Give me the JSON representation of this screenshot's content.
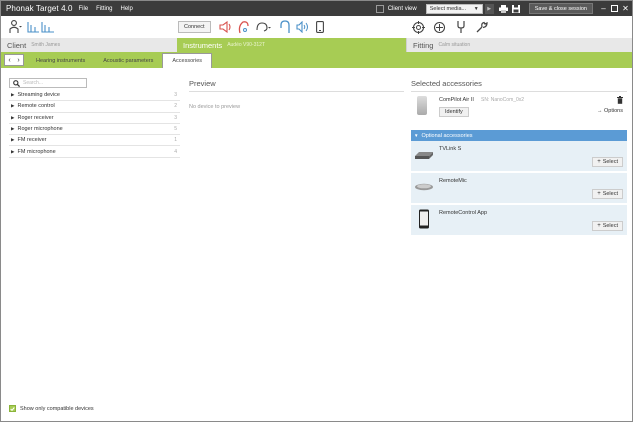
{
  "titlebar": {
    "app_title": "Phonak Target 4.0",
    "menu": [
      "File",
      "Fitting",
      "Help"
    ],
    "client_view_label": "Client view",
    "select_media": "Select media...",
    "save_close": "Save & close session",
    "icons": [
      "print-icon",
      "save-icon",
      "minimize-icon",
      "restore-icon",
      "close-icon"
    ]
  },
  "toolbar": {
    "connect_label": "Connect",
    "left_icons": [
      "person-icon",
      "audiogram-icon"
    ],
    "instrument_icons": [
      "speaker-icon",
      "hearing-aid-icon",
      "ear-icon",
      "hook-icon",
      "volume-icon",
      "phone-icon"
    ],
    "fitting_icons": [
      "target-icon",
      "crosshair-icon",
      "tuning-fork-icon",
      "wrench-icon"
    ]
  },
  "sections": {
    "client": {
      "name": "Client",
      "sub": "Smith James"
    },
    "instruments": {
      "name": "Instruments",
      "sub": "Audéo V90-312T"
    },
    "fitting": {
      "name": "Fitting",
      "sub": "Calm situation"
    }
  },
  "tabs": [
    "Hearing instruments",
    "Acoustic parameters",
    "Accessories"
  ],
  "active_tab": "Accessories",
  "search": {
    "placeholder": "Search..."
  },
  "categories": [
    {
      "name": "Streaming device",
      "count": "3"
    },
    {
      "name": "Remote control",
      "count": "2"
    },
    {
      "name": "Roger receiver",
      "count": "3"
    },
    {
      "name": "Roger microphone",
      "count": "5"
    },
    {
      "name": "FM receiver",
      "count": "1"
    },
    {
      "name": "FM microphone",
      "count": "4"
    }
  ],
  "preview": {
    "title": "Preview",
    "empty": "No device to preview"
  },
  "selected": {
    "title": "Selected accessories",
    "item": {
      "name": "ComPilot Air II",
      "sn": "SN: NanoCom_0x2"
    },
    "identify": "Identify",
    "options": "Options"
  },
  "optional": {
    "title": "Optional accessories",
    "select_label": "Select",
    "items": [
      {
        "name": "TVLink S"
      },
      {
        "name": "RemoteMic"
      },
      {
        "name": "RemoteControl App"
      }
    ]
  },
  "footer": {
    "show_compatible": "Show only compatible devices"
  },
  "colors": {
    "accent": "#a7cc54",
    "header_blue": "#5b9bd5",
    "titlebar": "#3c3c3c",
    "item_bg": "#e7f0f6"
  }
}
